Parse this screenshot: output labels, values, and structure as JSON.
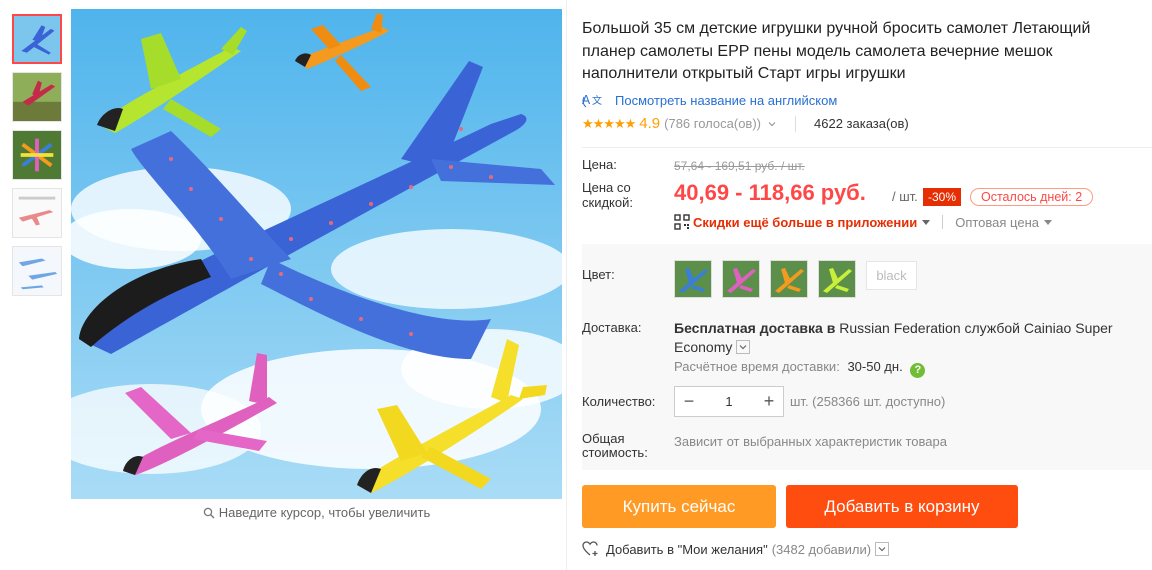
{
  "colors": {
    "accent_red": "#ff4747",
    "buy_button": "#ff9a24",
    "cart_button": "#ff4c0f",
    "link_blue": "#2770d3",
    "star": "#ff9e00"
  },
  "gallery": {
    "thumbnails": [
      {
        "name": "blue-plane-thumb",
        "active": true
      },
      {
        "name": "red-plane-thumb",
        "active": false
      },
      {
        "name": "color-planes-thumb",
        "active": false
      },
      {
        "name": "size-guide-thumb",
        "active": false
      },
      {
        "name": "parts-thumb",
        "active": false
      }
    ],
    "zoom_hint": "Наведите курсор, чтобы увеличить",
    "zoom_icon": "search-icon"
  },
  "product": {
    "title": "Большой 35 см детские игрушки ручной бросить самолет Летающий планер самолеты EPP пены модель самолета вечерние мешок наполнители открытый Старт игры игрушки",
    "translate_link": "Посмотреть название на английском",
    "rating_stars": "★★★★★",
    "rating_value": "4.9",
    "votes": "(786 голоса(ов))",
    "orders": "4622 заказа(ов)"
  },
  "price": {
    "label": "Цена:",
    "old_price": "57,64 - 169,51 руб. / шт.",
    "discount_label": "Цена со скидкой:",
    "new_price": "40,69 - 118,66 руб.",
    "per_unit": "/ шт.",
    "discount_badge": "-30%",
    "days_left": "Осталось дней: 2",
    "app_discount": "Скидки ещё больше в приложении",
    "wholesale": "Оптовая цена"
  },
  "options": {
    "color_label": "Цвет:",
    "swatches": [
      {
        "name": "swatch-blue",
        "color": "#3a7fd5"
      },
      {
        "name": "swatch-pink",
        "color": "#e060c0"
      },
      {
        "name": "swatch-orange",
        "color": "#f39a1f"
      },
      {
        "name": "swatch-green",
        "color": "#a6dd2a"
      }
    ],
    "black_swatch": "black"
  },
  "delivery": {
    "label": "Доставка:",
    "free_text": "Бесплатная доставка в",
    "destination": "Russian Federation службой Cainiao Super Economy",
    "time_label": "Расчётное время доставки:",
    "time_value": "30-50 дн."
  },
  "quantity": {
    "label": "Количество:",
    "value": "1",
    "minus": "−",
    "plus": "+",
    "available": "шт. (258366 шт. доступно)"
  },
  "total": {
    "label": "Общая стоимость:",
    "value": "Зависит от выбранных характеристик товара"
  },
  "actions": {
    "buy_now": "Купить сейчас",
    "add_to_cart": "Добавить в корзину",
    "wishlist": "Добавить в \"Мои желания\"",
    "wishlist_count": "(3482 добавили)"
  }
}
